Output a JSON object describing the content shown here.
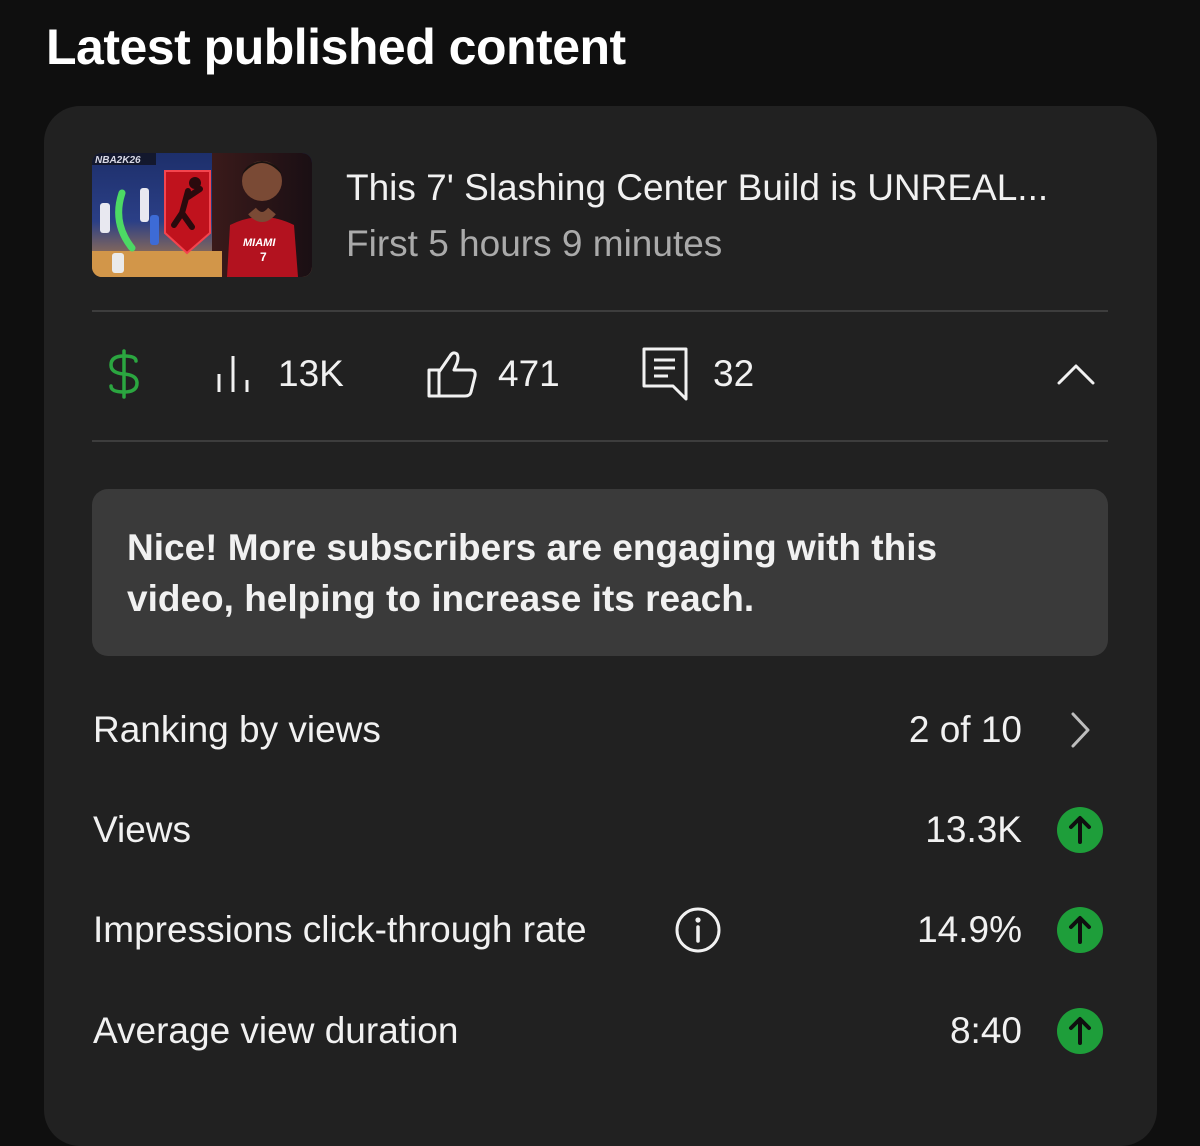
{
  "page": {
    "title": "Latest published content"
  },
  "video": {
    "title": "This 7' Slashing Center Build is UNREAL...",
    "subtitle": "First 5 hours 9 minutes",
    "thumbnail": {
      "game_label": "NBA2K26",
      "jersey_team": "MIAMI",
      "jersey_number": "7"
    }
  },
  "stats": {
    "monetization_icon": "dollar-icon",
    "views": "13K",
    "likes": "471",
    "comments": "32",
    "collapse_icon": "chevron-up-icon"
  },
  "insight": {
    "text": "Nice! More subscribers are engaging with this video, helping to increase its reach."
  },
  "metrics": [
    {
      "label": "Ranking by views",
      "value": "2 of 10",
      "trail": "chevron-right-icon"
    },
    {
      "label": "Views",
      "value": "13.3K",
      "trail": "arrow-up-icon"
    },
    {
      "label": "Impressions click-through rate",
      "value": "14.9%",
      "trail": "arrow-up-icon",
      "info": "info-icon"
    },
    {
      "label": "Average view duration",
      "value": "8:40",
      "trail": "arrow-up-icon"
    }
  ],
  "colors": {
    "background": "#0f0f0f",
    "card": "#212121",
    "insight_bg": "#3a3a3a",
    "accent_green": "#1e9e3a",
    "monetization_green": "#2ba640",
    "secondary_text": "#aaaaaa"
  }
}
